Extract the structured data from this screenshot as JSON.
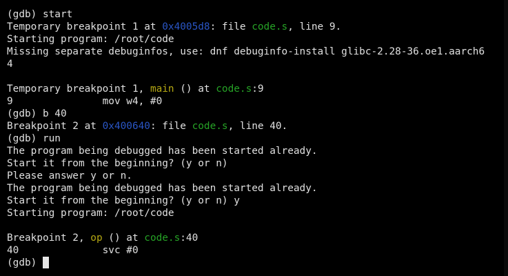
{
  "terminal": {
    "top_fragment": "     ",
    "lines": [
      {
        "segments": [
          {
            "text": "(gdb) start"
          }
        ]
      },
      {
        "segments": [
          {
            "text": "Temporary breakpoint 1 at "
          },
          {
            "text": "0x4005d8",
            "style": "addr"
          },
          {
            "text": ": file "
          },
          {
            "text": "code.s",
            "style": "file"
          },
          {
            "text": ", line 9."
          }
        ]
      },
      {
        "segments": [
          {
            "text": "Starting program: /root/code"
          }
        ]
      },
      {
        "segments": [
          {
            "text": "Missing separate debuginfos, use: dnf debuginfo-install glibc-2.28-36.oe1.aarch6"
          }
        ]
      },
      {
        "segments": [
          {
            "text": "4"
          }
        ]
      },
      {
        "segments": [
          {
            "text": ""
          }
        ]
      },
      {
        "segments": [
          {
            "text": "Temporary breakpoint 1, "
          },
          {
            "text": "main",
            "style": "func"
          },
          {
            "text": " () at "
          },
          {
            "text": "code.s",
            "style": "file"
          },
          {
            "text": ":9"
          }
        ]
      },
      {
        "segments": [
          {
            "text": "9               mov w4, #0"
          }
        ]
      },
      {
        "segments": [
          {
            "text": "(gdb) b 40"
          }
        ]
      },
      {
        "segments": [
          {
            "text": "Breakpoint 2 at "
          },
          {
            "text": "0x400640",
            "style": "addr"
          },
          {
            "text": ": file "
          },
          {
            "text": "code.s",
            "style": "file"
          },
          {
            "text": ", line 40."
          }
        ]
      },
      {
        "segments": [
          {
            "text": "(gdb) run"
          }
        ]
      },
      {
        "segments": [
          {
            "text": "The program being debugged has been started already."
          }
        ]
      },
      {
        "segments": [
          {
            "text": "Start it from the beginning? (y or n)"
          }
        ]
      },
      {
        "segments": [
          {
            "text": "Please answer y or n."
          }
        ]
      },
      {
        "segments": [
          {
            "text": "The program being debugged has been started already."
          }
        ]
      },
      {
        "segments": [
          {
            "text": "Start it from the beginning? (y or n) y"
          }
        ]
      },
      {
        "segments": [
          {
            "text": "Starting program: /root/code"
          }
        ]
      },
      {
        "segments": [
          {
            "text": ""
          }
        ]
      },
      {
        "segments": [
          {
            "text": "Breakpoint 2, "
          },
          {
            "text": "op",
            "style": "func"
          },
          {
            "text": " () at "
          },
          {
            "text": "code.s",
            "style": "file"
          },
          {
            "text": ":40"
          }
        ]
      },
      {
        "segments": [
          {
            "text": "40              svc #0"
          }
        ]
      }
    ],
    "prompt": "(gdb) ",
    "colors": {
      "background": "#000000",
      "text": "#e0e0e0",
      "address": "#2a56c6",
      "filename": "#26a326",
      "function": "#b5a813"
    }
  }
}
